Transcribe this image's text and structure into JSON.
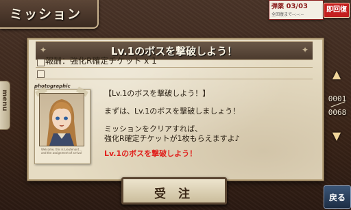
{
  "header": {
    "title": "ミッション"
  },
  "ammo": {
    "label": "弾薬",
    "value": "03/03",
    "recovery_text": "全回復まで--:--:--",
    "recover_button": "即回復"
  },
  "side_menu": {
    "label": "menu"
  },
  "mission": {
    "title": "Lv.1のボスを撃破しよう！",
    "reward": "報酬：強化R確定チケット x 1",
    "portrait_label": "photographic portrait",
    "portrait_caption": "Welcome, this is Lieutenant... and the assignment of arrival",
    "message_lines": [
      "【Lv.1のボスを撃破しよう！】",
      "まずは、Lv.1のボスを撃破しましょう！",
      "ミッションをクリアすれば、",
      "強化R確定チケットが1枚もらえますよ♪"
    ],
    "objective": "Lv.1のボスを撃破しよう！"
  },
  "pager": {
    "current": "0001",
    "total": "0068",
    "up_icon": "arrow-up-icon",
    "down_icon": "arrow-down-icon"
  },
  "buttons": {
    "accept": "受 注",
    "back": "戻る"
  },
  "colors": {
    "accent_red": "#e0201c",
    "paper": "#e6dcc3",
    "frame_dark": "#3d2a20"
  }
}
